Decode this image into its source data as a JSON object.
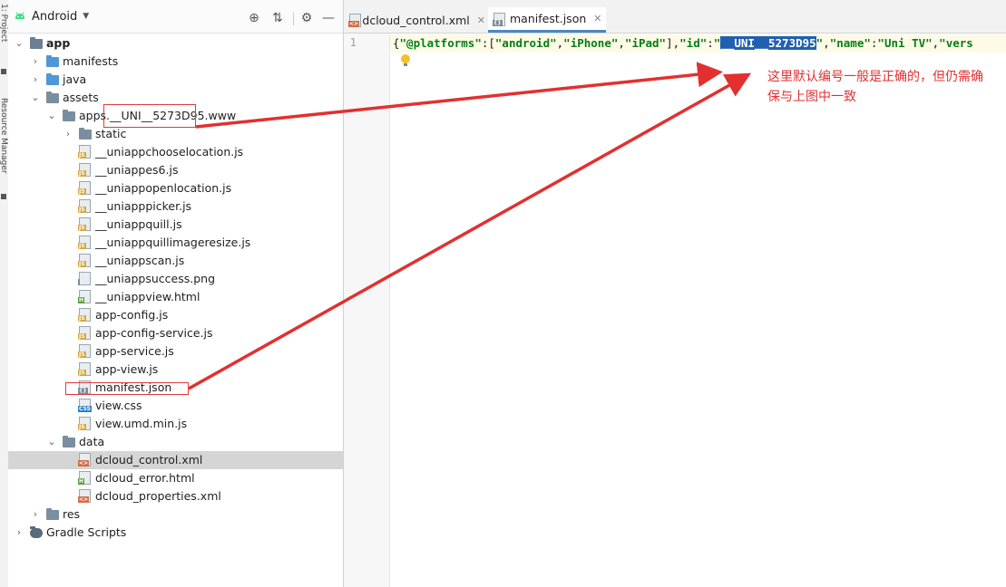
{
  "project_panel": {
    "title": "Android",
    "toolstrip_labels": [
      "1: Project",
      "Resource Manager"
    ]
  },
  "tree": [
    {
      "label": "app",
      "type": "module",
      "bold": true,
      "expanded": true
    },
    {
      "label": "manifests",
      "type": "folder-blue",
      "expanded": false
    },
    {
      "label": "java",
      "type": "folder-blue",
      "expanded": false
    },
    {
      "label": "assets",
      "type": "folder",
      "expanded": true
    },
    {
      "label": "apps.__UNI__5273D95.www",
      "type": "folder",
      "expanded": true
    },
    {
      "label": "static",
      "type": "folder",
      "expanded": false
    },
    {
      "label": "__uniappchooselocation.js",
      "type": "js"
    },
    {
      "label": "__uniappes6.js",
      "type": "js"
    },
    {
      "label": "__uniappopenlocation.js",
      "type": "js"
    },
    {
      "label": "__uniapppicker.js",
      "type": "js"
    },
    {
      "label": "__uniappquill.js",
      "type": "js"
    },
    {
      "label": "__uniappquillimageresize.js",
      "type": "js"
    },
    {
      "label": "__uniappscan.js",
      "type": "js"
    },
    {
      "label": "__uniappsuccess.png",
      "type": "img"
    },
    {
      "label": "__uniappview.html",
      "type": "html"
    },
    {
      "label": "app-config.js",
      "type": "js"
    },
    {
      "label": "app-config-service.js",
      "type": "js"
    },
    {
      "label": "app-service.js",
      "type": "js"
    },
    {
      "label": "app-view.js",
      "type": "js"
    },
    {
      "label": "manifest.json",
      "type": "json"
    },
    {
      "label": "view.css",
      "type": "css"
    },
    {
      "label": "view.umd.min.js",
      "type": "js"
    },
    {
      "label": "data",
      "type": "folder",
      "expanded": true
    },
    {
      "label": "dcloud_control.xml",
      "type": "xml",
      "selected": true
    },
    {
      "label": "dcloud_error.html",
      "type": "html"
    },
    {
      "label": "dcloud_properties.xml",
      "type": "xml"
    },
    {
      "label": "res",
      "type": "folder",
      "expanded": false
    },
    {
      "label": "Gradle Scripts",
      "type": "gradle",
      "expanded": false
    }
  ],
  "editor": {
    "tabs": [
      {
        "label": "dcloud_control.xml",
        "active": false
      },
      {
        "label": "manifest.json",
        "active": true
      }
    ],
    "line_number": "1",
    "code_tokens": [
      {
        "t": "{",
        "k": "brace"
      },
      {
        "t": "\"@platforms\"",
        "k": "str"
      },
      {
        "t": ":[",
        "k": "punc"
      },
      {
        "t": "\"android\"",
        "k": "str"
      },
      {
        "t": ",",
        "k": "punc"
      },
      {
        "t": "\"iPhone\"",
        "k": "str"
      },
      {
        "t": ",",
        "k": "punc"
      },
      {
        "t": "\"iPad\"",
        "k": "str"
      },
      {
        "t": "],",
        "k": "punc"
      },
      {
        "t": "\"id\"",
        "k": "str"
      },
      {
        "t": ":",
        "k": "punc"
      },
      {
        "t": "\"",
        "k": "str"
      },
      {
        "t": "__UNI__5273D95",
        "k": "sel"
      },
      {
        "t": "\"",
        "k": "str"
      },
      {
        "t": ",",
        "k": "punc"
      },
      {
        "t": "\"name\"",
        "k": "str"
      },
      {
        "t": ":",
        "k": "punc"
      },
      {
        "t": "\"Uni TV\"",
        "k": "str"
      },
      {
        "t": ",",
        "k": "punc"
      },
      {
        "t": "\"vers",
        "k": "str"
      }
    ]
  },
  "annotation": {
    "note": "这里默认编号一般是正确的，但仍需确保与上图中一致",
    "color": "#e23030"
  }
}
